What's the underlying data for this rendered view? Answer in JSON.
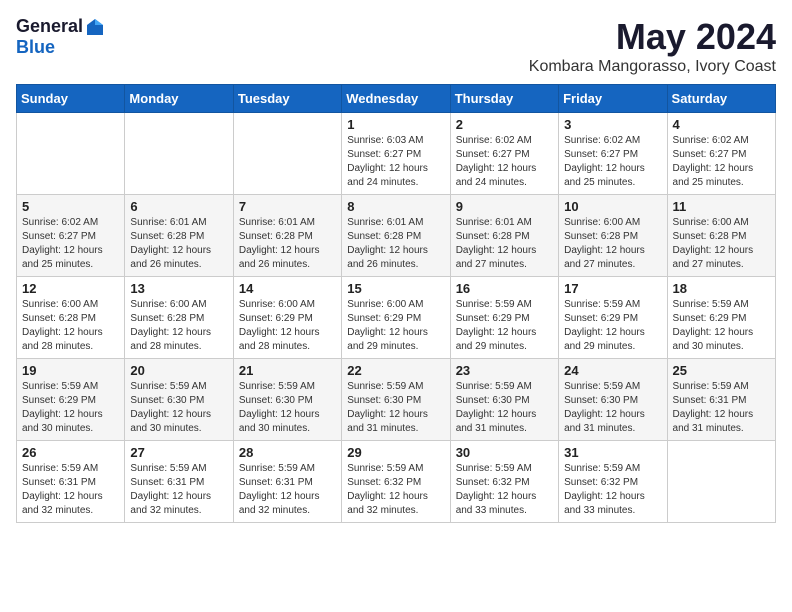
{
  "logo": {
    "general": "General",
    "blue": "Blue"
  },
  "header": {
    "month": "May 2024",
    "location": "Kombara Mangorasso, Ivory Coast"
  },
  "weekdays": [
    "Sunday",
    "Monday",
    "Tuesday",
    "Wednesday",
    "Thursday",
    "Friday",
    "Saturday"
  ],
  "weeks": [
    [
      {
        "day": "",
        "sunrise": "",
        "sunset": "",
        "daylight": ""
      },
      {
        "day": "",
        "sunrise": "",
        "sunset": "",
        "daylight": ""
      },
      {
        "day": "",
        "sunrise": "",
        "sunset": "",
        "daylight": ""
      },
      {
        "day": "1",
        "sunrise": "Sunrise: 6:03 AM",
        "sunset": "Sunset: 6:27 PM",
        "daylight": "Daylight: 12 hours and 24 minutes."
      },
      {
        "day": "2",
        "sunrise": "Sunrise: 6:02 AM",
        "sunset": "Sunset: 6:27 PM",
        "daylight": "Daylight: 12 hours and 24 minutes."
      },
      {
        "day": "3",
        "sunrise": "Sunrise: 6:02 AM",
        "sunset": "Sunset: 6:27 PM",
        "daylight": "Daylight: 12 hours and 25 minutes."
      },
      {
        "day": "4",
        "sunrise": "Sunrise: 6:02 AM",
        "sunset": "Sunset: 6:27 PM",
        "daylight": "Daylight: 12 hours and 25 minutes."
      }
    ],
    [
      {
        "day": "5",
        "sunrise": "Sunrise: 6:02 AM",
        "sunset": "Sunset: 6:27 PM",
        "daylight": "Daylight: 12 hours and 25 minutes."
      },
      {
        "day": "6",
        "sunrise": "Sunrise: 6:01 AM",
        "sunset": "Sunset: 6:28 PM",
        "daylight": "Daylight: 12 hours and 26 minutes."
      },
      {
        "day": "7",
        "sunrise": "Sunrise: 6:01 AM",
        "sunset": "Sunset: 6:28 PM",
        "daylight": "Daylight: 12 hours and 26 minutes."
      },
      {
        "day": "8",
        "sunrise": "Sunrise: 6:01 AM",
        "sunset": "Sunset: 6:28 PM",
        "daylight": "Daylight: 12 hours and 26 minutes."
      },
      {
        "day": "9",
        "sunrise": "Sunrise: 6:01 AM",
        "sunset": "Sunset: 6:28 PM",
        "daylight": "Daylight: 12 hours and 27 minutes."
      },
      {
        "day": "10",
        "sunrise": "Sunrise: 6:00 AM",
        "sunset": "Sunset: 6:28 PM",
        "daylight": "Daylight: 12 hours and 27 minutes."
      },
      {
        "day": "11",
        "sunrise": "Sunrise: 6:00 AM",
        "sunset": "Sunset: 6:28 PM",
        "daylight": "Daylight: 12 hours and 27 minutes."
      }
    ],
    [
      {
        "day": "12",
        "sunrise": "Sunrise: 6:00 AM",
        "sunset": "Sunset: 6:28 PM",
        "daylight": "Daylight: 12 hours and 28 minutes."
      },
      {
        "day": "13",
        "sunrise": "Sunrise: 6:00 AM",
        "sunset": "Sunset: 6:28 PM",
        "daylight": "Daylight: 12 hours and 28 minutes."
      },
      {
        "day": "14",
        "sunrise": "Sunrise: 6:00 AM",
        "sunset": "Sunset: 6:29 PM",
        "daylight": "Daylight: 12 hours and 28 minutes."
      },
      {
        "day": "15",
        "sunrise": "Sunrise: 6:00 AM",
        "sunset": "Sunset: 6:29 PM",
        "daylight": "Daylight: 12 hours and 29 minutes."
      },
      {
        "day": "16",
        "sunrise": "Sunrise: 5:59 AM",
        "sunset": "Sunset: 6:29 PM",
        "daylight": "Daylight: 12 hours and 29 minutes."
      },
      {
        "day": "17",
        "sunrise": "Sunrise: 5:59 AM",
        "sunset": "Sunset: 6:29 PM",
        "daylight": "Daylight: 12 hours and 29 minutes."
      },
      {
        "day": "18",
        "sunrise": "Sunrise: 5:59 AM",
        "sunset": "Sunset: 6:29 PM",
        "daylight": "Daylight: 12 hours and 30 minutes."
      }
    ],
    [
      {
        "day": "19",
        "sunrise": "Sunrise: 5:59 AM",
        "sunset": "Sunset: 6:29 PM",
        "daylight": "Daylight: 12 hours and 30 minutes."
      },
      {
        "day": "20",
        "sunrise": "Sunrise: 5:59 AM",
        "sunset": "Sunset: 6:30 PM",
        "daylight": "Daylight: 12 hours and 30 minutes."
      },
      {
        "day": "21",
        "sunrise": "Sunrise: 5:59 AM",
        "sunset": "Sunset: 6:30 PM",
        "daylight": "Daylight: 12 hours and 30 minutes."
      },
      {
        "day": "22",
        "sunrise": "Sunrise: 5:59 AM",
        "sunset": "Sunset: 6:30 PM",
        "daylight": "Daylight: 12 hours and 31 minutes."
      },
      {
        "day": "23",
        "sunrise": "Sunrise: 5:59 AM",
        "sunset": "Sunset: 6:30 PM",
        "daylight": "Daylight: 12 hours and 31 minutes."
      },
      {
        "day": "24",
        "sunrise": "Sunrise: 5:59 AM",
        "sunset": "Sunset: 6:30 PM",
        "daylight": "Daylight: 12 hours and 31 minutes."
      },
      {
        "day": "25",
        "sunrise": "Sunrise: 5:59 AM",
        "sunset": "Sunset: 6:31 PM",
        "daylight": "Daylight: 12 hours and 31 minutes."
      }
    ],
    [
      {
        "day": "26",
        "sunrise": "Sunrise: 5:59 AM",
        "sunset": "Sunset: 6:31 PM",
        "daylight": "Daylight: 12 hours and 32 minutes."
      },
      {
        "day": "27",
        "sunrise": "Sunrise: 5:59 AM",
        "sunset": "Sunset: 6:31 PM",
        "daylight": "Daylight: 12 hours and 32 minutes."
      },
      {
        "day": "28",
        "sunrise": "Sunrise: 5:59 AM",
        "sunset": "Sunset: 6:31 PM",
        "daylight": "Daylight: 12 hours and 32 minutes."
      },
      {
        "day": "29",
        "sunrise": "Sunrise: 5:59 AM",
        "sunset": "Sunset: 6:32 PM",
        "daylight": "Daylight: 12 hours and 32 minutes."
      },
      {
        "day": "30",
        "sunrise": "Sunrise: 5:59 AM",
        "sunset": "Sunset: 6:32 PM",
        "daylight": "Daylight: 12 hours and 33 minutes."
      },
      {
        "day": "31",
        "sunrise": "Sunrise: 5:59 AM",
        "sunset": "Sunset: 6:32 PM",
        "daylight": "Daylight: 12 hours and 33 minutes."
      },
      {
        "day": "",
        "sunrise": "",
        "sunset": "",
        "daylight": ""
      }
    ]
  ]
}
